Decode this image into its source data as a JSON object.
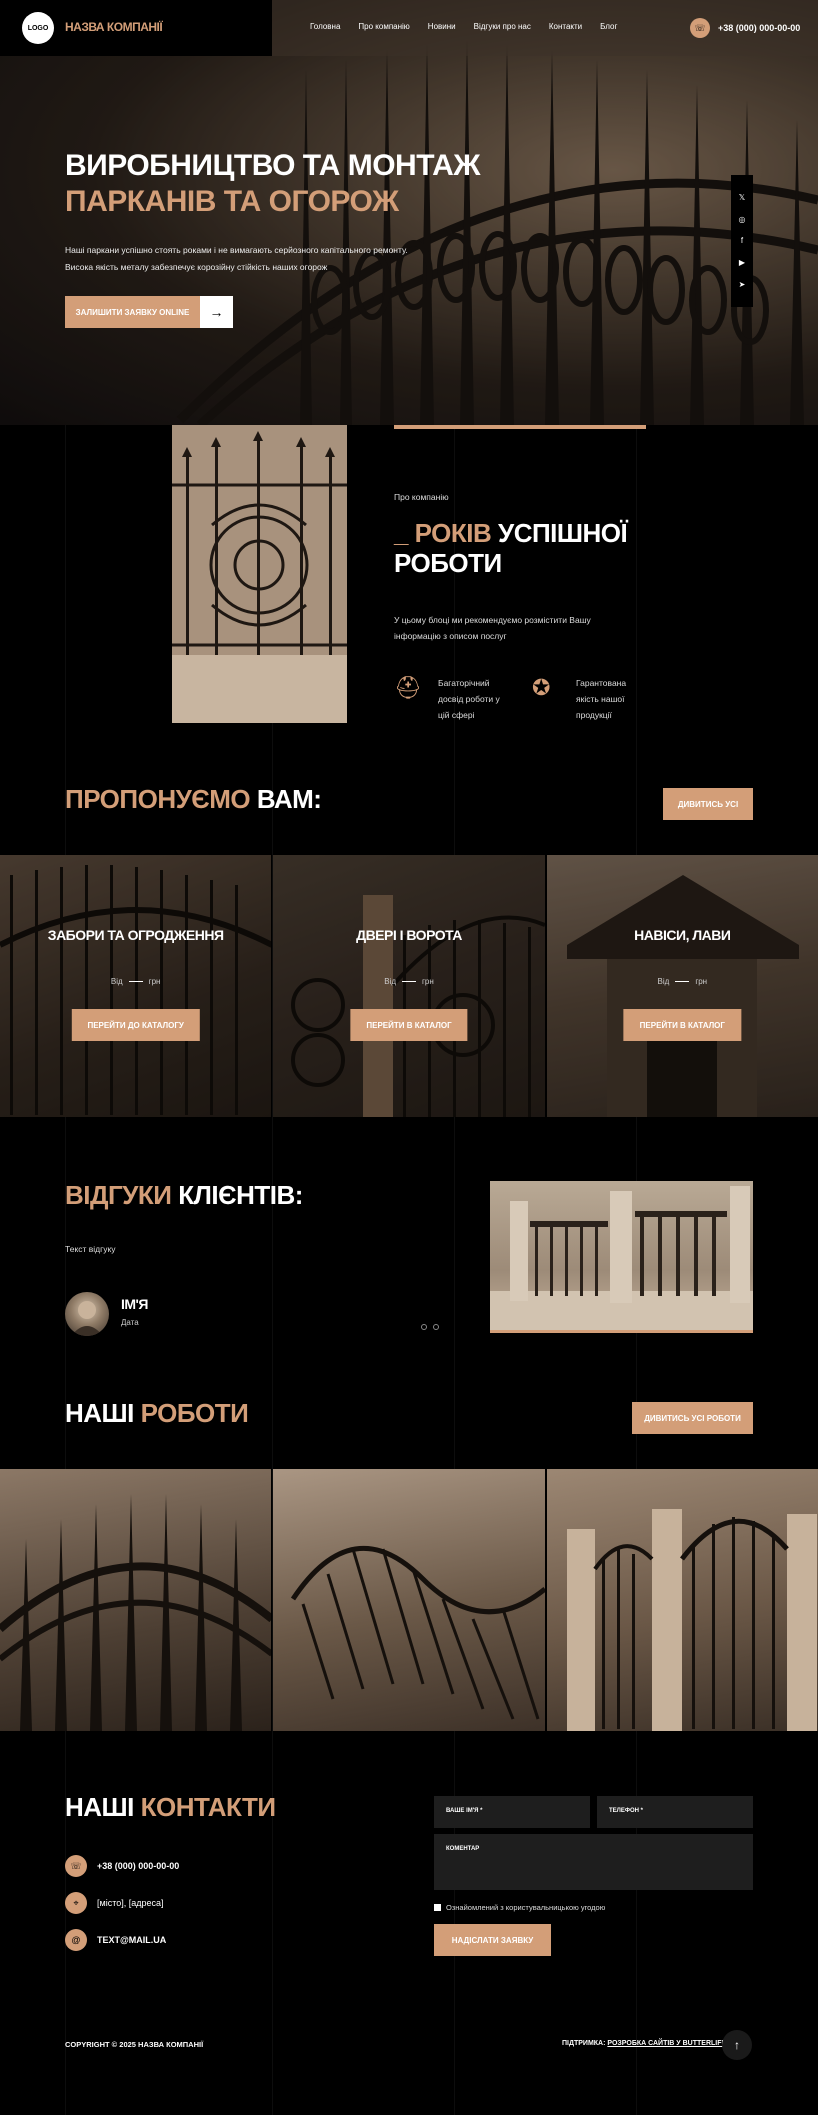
{
  "header": {
    "logo": "LOGO",
    "company": "НАЗВА КОМПАНІЇ",
    "nav": [
      "Головна",
      "Про компанію",
      "Новини",
      "Відгуки про нас",
      "Контакти",
      "Блог"
    ],
    "phone": "+38 (000) 000-00-00"
  },
  "hero": {
    "title_line1": "ВИРОБНИЦТВО ТА МОНТАЖ",
    "title_line2": "ПАРКАНІВ ТА ОГОРОЖ",
    "text_line1": "Наші паркани успішно стоять роками і не вимагають серйозного капітального ремонту.",
    "text_line2": "Висока якість металу забезпечує корозійну стійкість наших огорож",
    "button": "ЗАЛИШИТИ ЗАЯВКУ ONLINE",
    "social_icons": [
      "twitter-icon",
      "instagram-icon",
      "facebook-icon",
      "youtube-icon",
      "telegram-icon"
    ]
  },
  "about": {
    "label": "Про компанію",
    "title_accent": "_ РОКІВ",
    "title_rest1": "УСПІШНОЇ",
    "title_rest2": "РОБОТИ",
    "text": "У цьому блоці ми рекомендуємо розмістити Вашу інформацію з описом послуг",
    "feature1": "Багаторічний досвід роботи у цій сфері",
    "feature2": "Гарантована якість нашої продукції"
  },
  "offers": {
    "title_accent": "ПРОПОНУЄМО",
    "title_rest": "ВАМ:",
    "view_all": "ДИВИТИСЬ УСІ",
    "price_from": "Від",
    "price_unit": "грн",
    "cards": [
      {
        "title": "ЗАБОРИ ТА ОГРОДЖЕННЯ",
        "button": "ПЕРЕЙТИ ДО КАТАЛОГУ"
      },
      {
        "title": "ДВЕРІ І ВОРОТА",
        "button": "ПЕРЕЙТИ В КАТАЛОГ"
      },
      {
        "title": "НАВІСИ, ЛАВИ",
        "button": "ПЕРЕЙТИ В КАТАЛОГ"
      }
    ]
  },
  "reviews": {
    "title_accent": "ВІДГУКИ",
    "title_rest": "КЛІЄНТІВ:",
    "text": "Текст відгуку",
    "name": "ІМ'Я",
    "date": "Дата"
  },
  "works": {
    "title_rest": "НАШІ",
    "title_accent": "РОБОТИ",
    "view_all": "ДИВИТИСЬ УСІ РОБОТИ"
  },
  "contacts": {
    "title_rest": "НАШІ",
    "title_accent": "КОНТАКТИ",
    "phone": "+38 (000) 000-00-00",
    "address": "[місто], [адреса]",
    "email": "TEXT@MAIL.UA",
    "field_name": "ВАШЕ ІМ'Я *",
    "field_phone": "ТЕЛЕФОН *",
    "field_comment": "КОМЕНТАР",
    "agree": "Ознайомлений з користувальницькою угодою",
    "submit": "НАДІСЛАТИ ЗАЯВКУ"
  },
  "footer": {
    "copyright": "COPYRIGHT © 2025 НАЗВА КОМПАНІЇ",
    "support_prefix": "ПІДТРИМКА:",
    "support_link": "РОЗРОБКА САЙТІВ У BUTTERLIFE"
  },
  "colors": {
    "accent": "#d39e78",
    "background": "#000000",
    "field": "#1e1e1e"
  }
}
